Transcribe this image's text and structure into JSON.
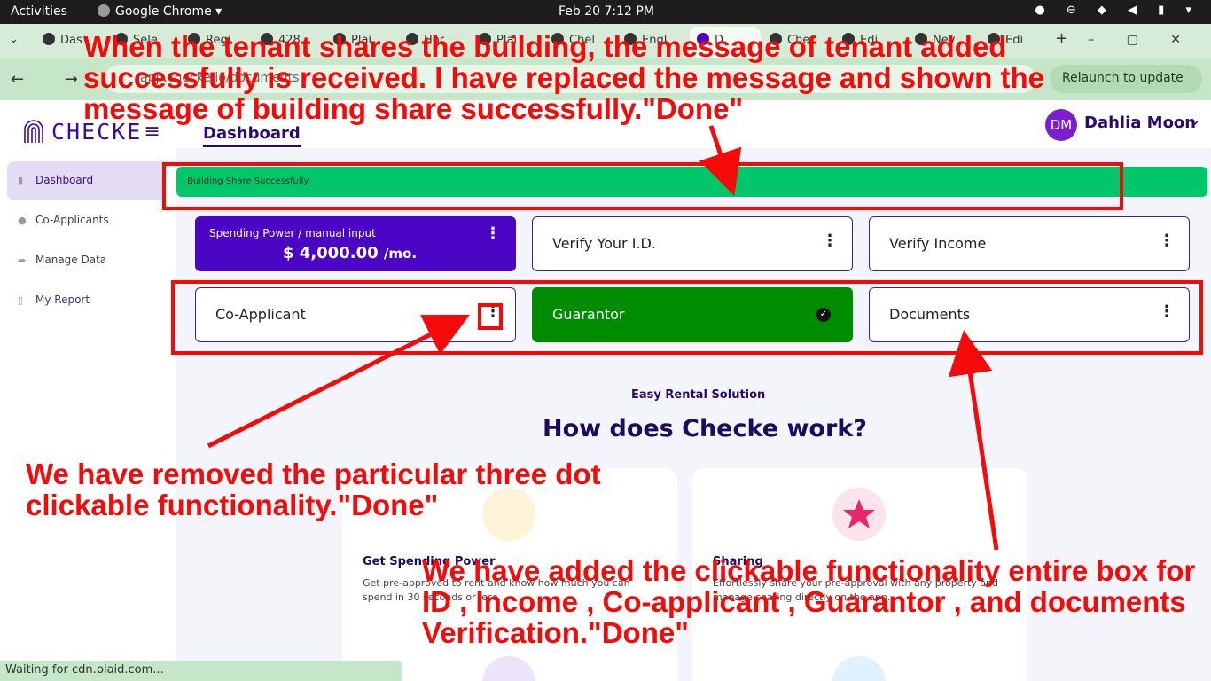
{
  "os": {
    "activities": "Activities",
    "app": "Google Chrome",
    "clock": "Feb 20  7:12 PM"
  },
  "browser": {
    "tabs": [
      "Das",
      "Sele",
      "Regi",
      "428",
      "Plai",
      "Hor",
      "Plai",
      "Chel",
      "Engl",
      "D",
      "Che",
      "Edi",
      "Nev",
      "Edi"
    ],
    "address": "app.checke.io/documents",
    "relaunch": "Relaunch to update"
  },
  "sidebar": {
    "logo": "CHECKE",
    "items": [
      {
        "label": "Dashboard",
        "icon": "document-icon"
      },
      {
        "label": "Co-Applicants",
        "icon": "person-icon"
      },
      {
        "label": "Manage Data",
        "icon": "share-icon"
      },
      {
        "label": "My Report",
        "icon": "file-icon"
      }
    ]
  },
  "header": {
    "page_title": "Dashboard",
    "avatar_initials": "DM",
    "user_name": "Dahlia Moon"
  },
  "toast": {
    "text": "Building Share Successfully",
    "color": "#02c76a"
  },
  "cards": {
    "spending": {
      "label": "Spending Power / manual input",
      "amount": "$ 4,000.00",
      "unit": "/mo."
    },
    "verify_id": "Verify Your I.D.",
    "verify_income": "Verify Income",
    "co_applicant": "Co-Applicant",
    "guarantor": "Guarantor",
    "documents": "Documents"
  },
  "how_it_works": {
    "eyebrow": "Easy Rental Solution",
    "title": "How does Checke work?",
    "features": [
      {
        "title": "Get Spending Power",
        "desc": "Get pre-approved to rent and know how much you can spend in 30 seconds or less."
      },
      {
        "title": "Sharing",
        "desc": "Effortlessly share your pre-approval with any property and manage sharing directly on the app."
      }
    ]
  },
  "status": "Waiting for cdn.plaid.com...",
  "annotations": {
    "top": "When the tenant shares the building, the message of tenant added successfully is received. I have replaced the message and shown the message of building share successfully.\"Done\"",
    "left": "We have removed the particular three dot clickable functionality.\"Done\"",
    "bottom": "We have added the clickable functionality entire box for ID , Income , Co-applicant , Guarantor , and documents Verification.\"Done\"",
    "color": "#f50a0a"
  }
}
